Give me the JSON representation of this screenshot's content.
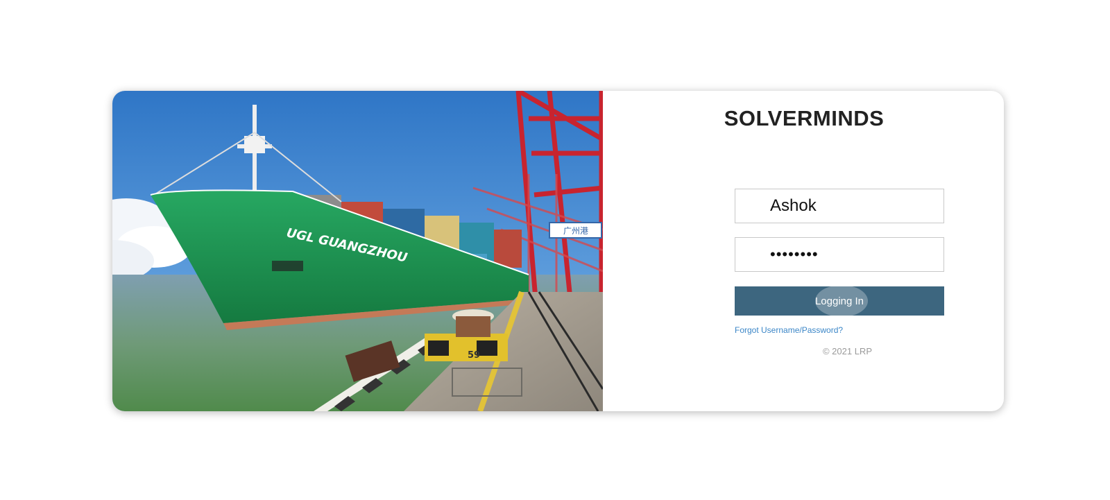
{
  "brand": {
    "title": "SOLVERMINDS"
  },
  "login": {
    "username_value": "Ashok",
    "password_value": "••••••••",
    "button_label": "Logging In",
    "forgot_link": "Forgot Username/Password?",
    "copyright": "© 2021 LRP"
  },
  "photo": {
    "ship_name": "UGL GUANGZHOU",
    "bollard_number": "59",
    "port_sign": "广州港"
  },
  "colors": {
    "button": "#3d667f",
    "link": "#3b86c7",
    "hull": "#1f9a55"
  }
}
